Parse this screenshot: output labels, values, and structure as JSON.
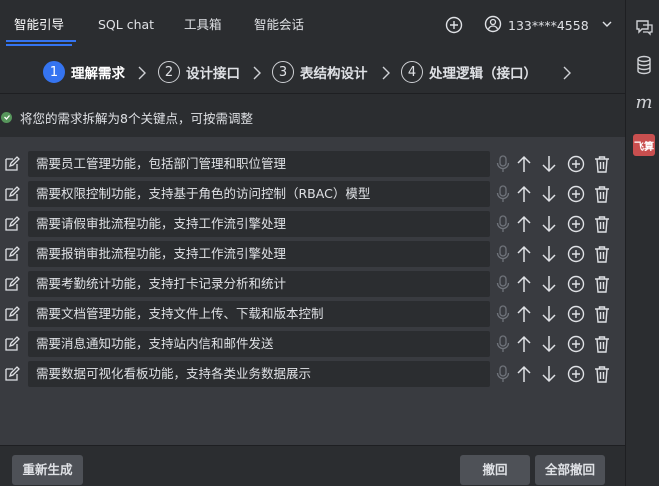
{
  "tabs": [
    {
      "label": "智能引导",
      "active": true
    },
    {
      "label": "SQL chat",
      "active": false
    },
    {
      "label": "工具箱",
      "active": false
    },
    {
      "label": "智能会话",
      "active": false
    }
  ],
  "user": {
    "phone": "133****4558"
  },
  "steps": [
    {
      "num": "1",
      "label": "理解需求",
      "active": true
    },
    {
      "num": "2",
      "label": "设计接口",
      "active": false
    },
    {
      "num": "3",
      "label": "表结构设计",
      "active": false
    },
    {
      "num": "4",
      "label": "处理逻辑（接口）",
      "active": false
    }
  ],
  "status_text": "将您的需求拆解为8个关键点，可按需调整",
  "requirements": [
    "需要员工管理功能，包括部门管理和职位管理",
    "需要权限控制功能，支持基于角色的访问控制（RBAC）模型",
    "需要请假审批流程功能，支持工作流引擎处理",
    "需要报销审批流程功能，支持工作流引擎处理",
    "需要考勤统计功能，支持打卡记录分析和统计",
    "需要文档管理功能，支持文件上传、下载和版本控制",
    "需要消息通知功能，支持站内信和邮件发送",
    "需要数据可视化看板功能，支持各类业务数据展示"
  ],
  "footer": {
    "regenerate": "重新生成",
    "undo": "撤回",
    "undo_all": "全部撤回"
  },
  "rightbar": {
    "feishu_label": "飞算",
    "m_label": "m"
  },
  "colors": {
    "accent": "#3574f0",
    "success": "#57965c",
    "feishu": "#c94f4f"
  }
}
